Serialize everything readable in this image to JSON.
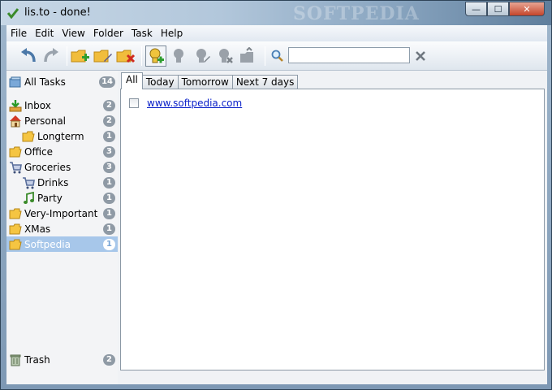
{
  "window": {
    "title": "lis.to - done!",
    "watermark": "SOFTPEDIA",
    "controls": {
      "minimize": "—",
      "maximize": "☐",
      "close": "✕"
    }
  },
  "menu": [
    "File",
    "Edit",
    "View",
    "Folder",
    "Task",
    "Help"
  ],
  "toolbar": {
    "icons": [
      "undo-icon",
      "redo-icon",
      "new-folder-icon",
      "edit-folder-icon",
      "delete-folder-icon",
      "new-task-icon",
      "task-priority-icon",
      "task-edit-icon",
      "task-delete-icon",
      "task-move-icon",
      "search-icon",
      "clear-search-icon"
    ],
    "search": {
      "value": "",
      "placeholder": ""
    }
  },
  "sidebar": {
    "all_tasks": {
      "label": "All Tasks",
      "count": "14"
    },
    "folders": [
      {
        "label": "Inbox",
        "count": "2",
        "icon": "inbox-icon"
      },
      {
        "label": "Personal",
        "count": "2",
        "icon": "house-icon"
      },
      {
        "label": "Longterm",
        "count": "1",
        "icon": "folder-icon"
      },
      {
        "label": "Office",
        "count": "3",
        "icon": "folder-icon"
      },
      {
        "label": "Groceries",
        "count": "3",
        "icon": "cart-icon"
      },
      {
        "label": "Drinks",
        "count": "1",
        "icon": "cart-icon"
      },
      {
        "label": "Party",
        "count": "1",
        "icon": "music-note-icon"
      },
      {
        "label": "Very-Important",
        "count": "1",
        "icon": "folder-icon"
      },
      {
        "label": "XMas",
        "count": "1",
        "icon": "folder-icon"
      },
      {
        "label": "Softpedia",
        "count": "1",
        "icon": "folder-icon",
        "selected": true
      }
    ],
    "trash": {
      "label": "Trash",
      "count": "2"
    }
  },
  "tabs": [
    "All",
    "Today",
    "Tomorrow",
    "Next 7 days"
  ],
  "active_tab": "All",
  "tasks": [
    {
      "text": "www.softpedia.com",
      "checked": false
    }
  ],
  "colors": {
    "selection": "#a7c7ea",
    "link": "#0b21c9",
    "badge": "#8f9aa5",
    "folder_yellow": "#f5c542"
  }
}
